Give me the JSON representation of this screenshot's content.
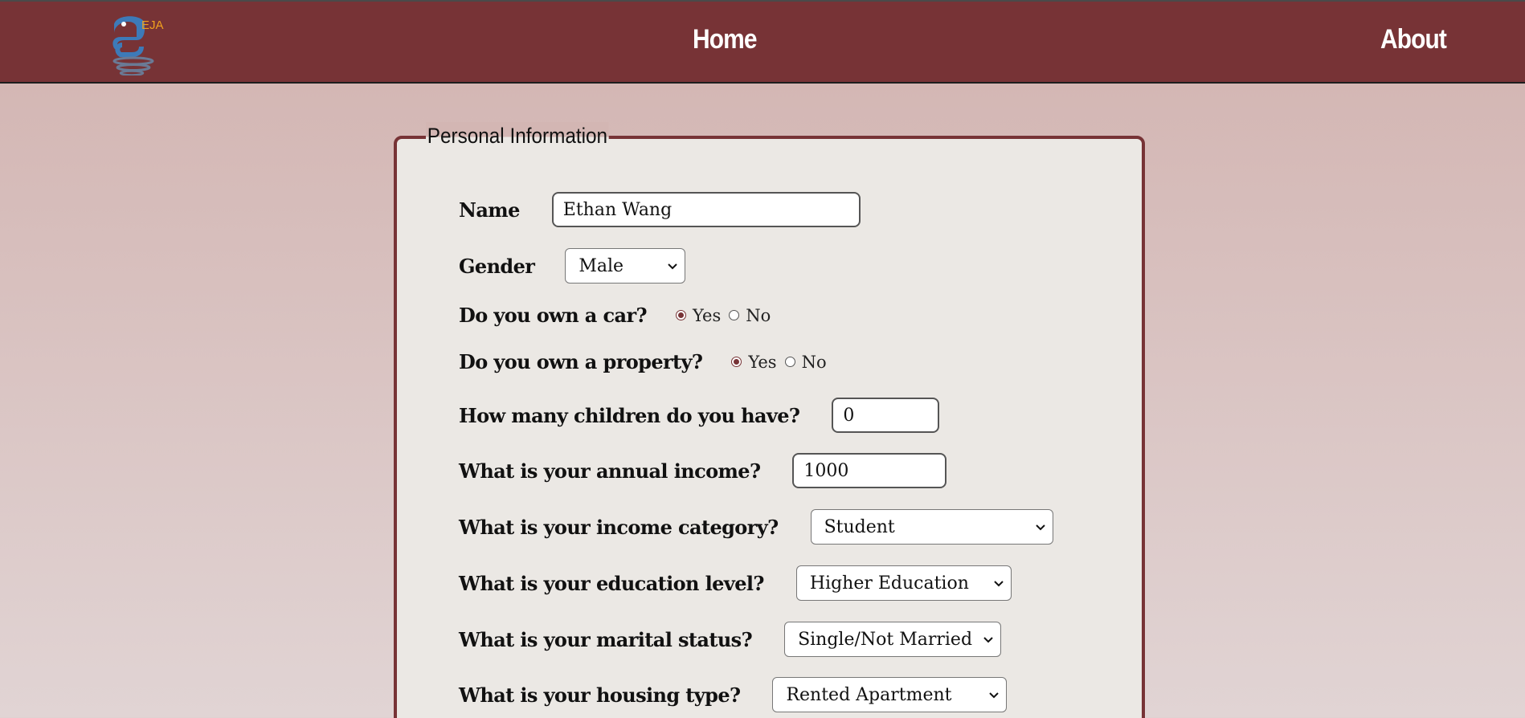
{
  "nav": {
    "logo_text": "EJA",
    "home": "Home",
    "about": "About"
  },
  "form": {
    "legend": "Personal Information",
    "name": {
      "label": "Name",
      "value": "Ethan Wang"
    },
    "gender": {
      "label": "Gender",
      "selected": "Male"
    },
    "car": {
      "label": "Do you own a car?",
      "yes": "Yes",
      "no": "No",
      "selected": "Yes"
    },
    "property": {
      "label": "Do you own a property?",
      "yes": "Yes",
      "no": "No",
      "selected": "Yes"
    },
    "children": {
      "label": "How many children do you have?",
      "value": "0"
    },
    "income": {
      "label": "What is your annual income?",
      "value": "1000"
    },
    "income_category": {
      "label": "What is your income category?",
      "selected": "Student"
    },
    "education": {
      "label": "What is your education level?",
      "selected": "Higher Education"
    },
    "marital": {
      "label": "What is your marital status?",
      "selected": "Single/Not Married"
    },
    "housing": {
      "label": "What is your housing type?",
      "selected": "Rented Apartment"
    }
  },
  "colors": {
    "header": "#773336",
    "page_top": "#d2b3b0",
    "page_bottom": "#e1d4d4",
    "panel": "#ebe8e4",
    "logo_blue": "#3d7ab8",
    "logo_orange": "#f0a01e"
  }
}
